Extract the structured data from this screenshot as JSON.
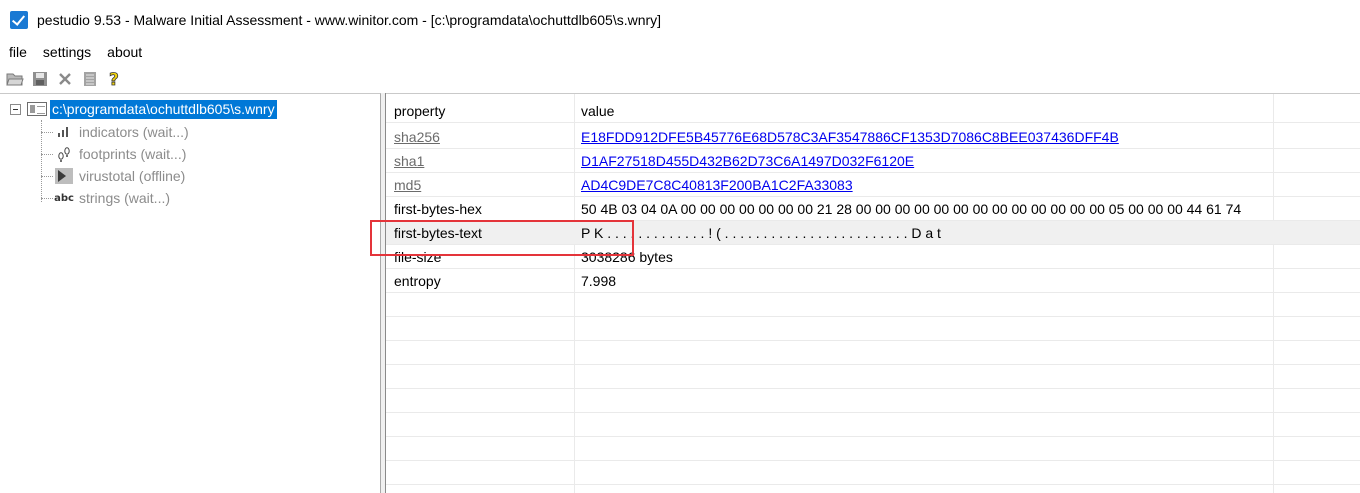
{
  "window": {
    "title": "pestudio 9.53 - Malware Initial Assessment - www.winitor.com - [c:\\programdata\\ochuttdlb605\\s.wnry]"
  },
  "menu": {
    "items": [
      "file",
      "settings",
      "about"
    ]
  },
  "toolbar": {
    "buttons": [
      "open-folder-icon",
      "save-icon",
      "close-icon",
      "document-icon",
      "help-icon"
    ]
  },
  "tree": {
    "root_label": "c:\\programdata\\ochuttdlb605\\s.wnry",
    "children": [
      {
        "label": "indicators (wait...)",
        "icon": "bar-chart-icon"
      },
      {
        "label": "footprints (wait...)",
        "icon": "footprints-icon"
      },
      {
        "label": "virustotal (offline)",
        "icon": "virustotal-icon"
      },
      {
        "label": "strings (wait...)",
        "icon": "abc-icon"
      }
    ]
  },
  "table": {
    "headers": {
      "property": "property",
      "value": "value"
    },
    "rows": [
      {
        "property": "sha256",
        "value": "E18FDD912DFE5B45776E68D578C3AF3547886CF1353D7086C8BEE037436DFF4B",
        "link": true
      },
      {
        "property": "sha1",
        "value": "D1AF27518D455D432B62D73C6A1497D032F6120E",
        "link": true
      },
      {
        "property": "md5",
        "value": "AD4C9DE7C8C40813F200BA1C2FA33083",
        "link": true
      },
      {
        "property": "first-bytes-hex",
        "value": "50 4B 03 04 0A 00 00 00 00 00 00 00 21 28 00 00 00 00 00 00 00 00 00 00 00 00 00 05 00 00 00 44 61 74",
        "link": false
      },
      {
        "property": "first-bytes-text",
        "value": "P K . . . . . . . . . . . . . ! ( . . . . . . . . . . . . . . . . . . . . . . . . D a t",
        "link": false,
        "highlighted": true
      },
      {
        "property": "file-size",
        "value": "3038286 bytes",
        "link": false
      },
      {
        "property": "entropy",
        "value": "7.998",
        "link": false
      }
    ]
  },
  "colors": {
    "selection": "#0078d7",
    "highlight_box": "#e4343a",
    "link": "#0000ee"
  }
}
